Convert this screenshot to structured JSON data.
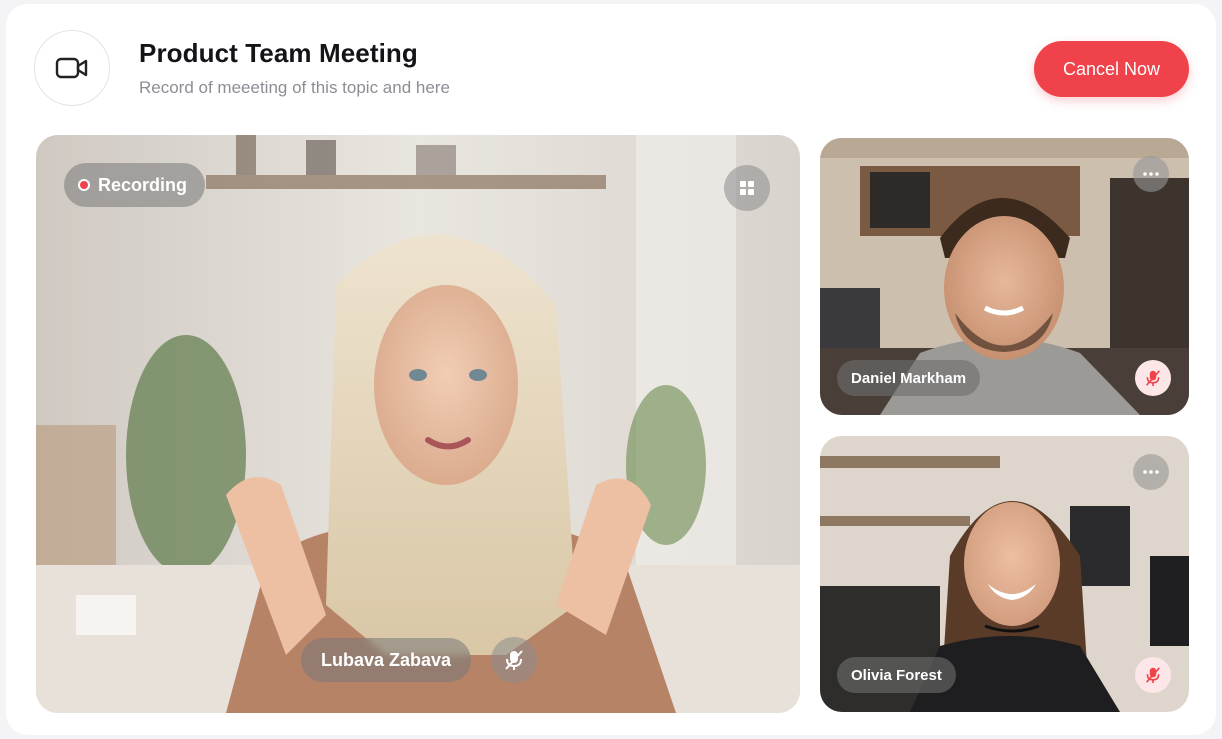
{
  "header": {
    "title": "Product Team Meeting",
    "subtitle": "Record of meeeting of this topic and here",
    "icon": "video-camera-icon",
    "cancel_label": "Cancel Now",
    "cancel_color": "#f0424a"
  },
  "main_video": {
    "recording_label": "Recording",
    "participant_name": "Lubava Zabava",
    "layout_icon": "grid-icon",
    "mic_icon": "mic-off-icon"
  },
  "participants": [
    {
      "name": "Daniel Markham",
      "menu_icon": "more-icon",
      "mic_icon": "mic-off-icon",
      "mic_status_color": "#f0424a"
    },
    {
      "name": "Olivia Forest",
      "menu_icon": "more-icon",
      "mic_icon": "mic-off-icon",
      "mic_status_color": "#f0424a"
    }
  ]
}
